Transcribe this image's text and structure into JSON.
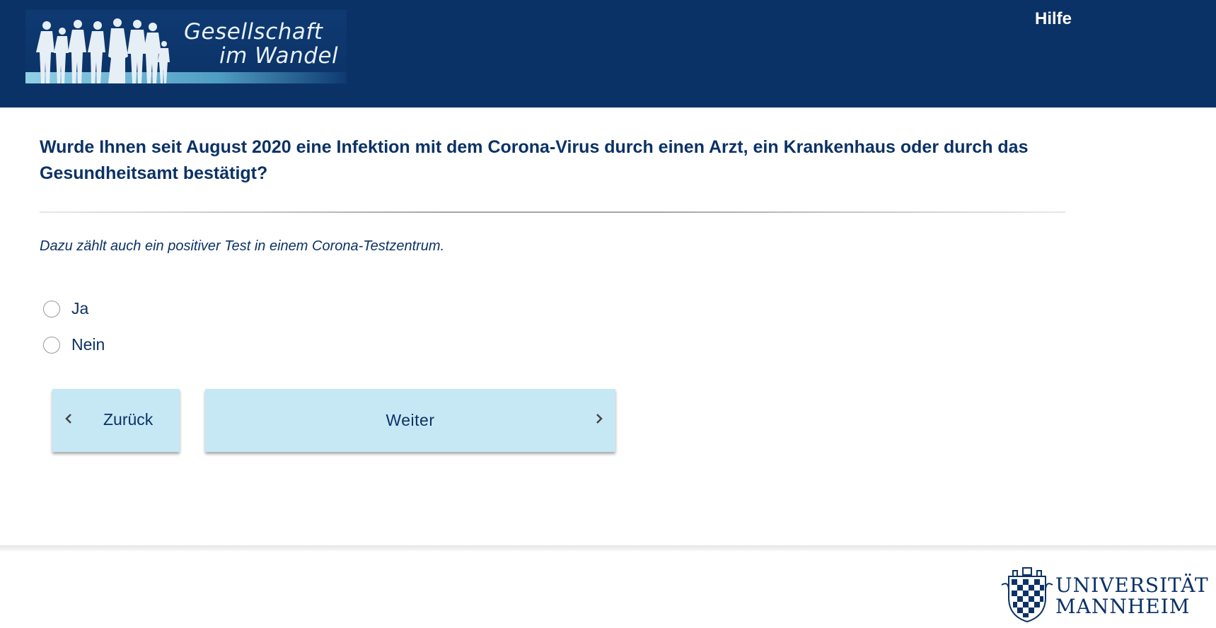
{
  "header": {
    "logo": {
      "line1": "Gesellschaft",
      "line2": "im Wandel",
      "icon": "people-silhouettes-logo"
    },
    "help_label": "Hilfe",
    "background_color": "#0b3266"
  },
  "question": {
    "text": "Wurde Ihnen seit August 2020 eine Infektion mit dem Corona-Virus durch einen Arzt, ein Krankenhaus oder durch das Gesundheitsamt bestätigt?",
    "hint": "Dazu zählt auch ein positiver Test in einem Corona-Testzentrum."
  },
  "options": [
    {
      "label": "Ja",
      "selected": false
    },
    {
      "label": "Nein",
      "selected": false
    }
  ],
  "navigation": {
    "back_label": "Zurück",
    "next_label": "Weiter",
    "button_color": "#c6e8f4",
    "back_icon": "chevron-left-icon",
    "next_icon": "chevron-right-icon"
  },
  "footer": {
    "university_line1": "UNIVERSITÄT",
    "university_line2": "MANNHEIM",
    "icon": "university-crest-icon"
  }
}
